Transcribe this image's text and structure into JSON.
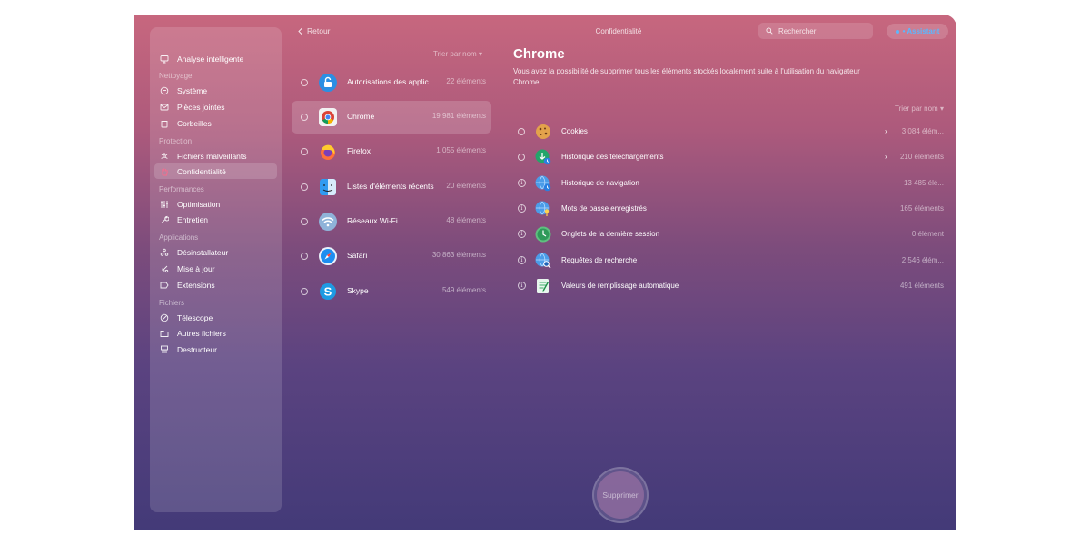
{
  "sidebar": {
    "top_item": {
      "label": "Analyse intelligente",
      "icon": "monitor-icon"
    },
    "sections": [
      {
        "title": "Nettoyage",
        "items": [
          {
            "label": "Système",
            "icon": "system-icon"
          },
          {
            "label": "Pièces jointes",
            "icon": "mail-icon"
          },
          {
            "label": "Corbeilles",
            "icon": "trash-icon"
          }
        ]
      },
      {
        "title": "Protection",
        "items": [
          {
            "label": "Fichiers malveillants",
            "icon": "biohazard-icon"
          },
          {
            "label": "Confidentialité",
            "icon": "hand-icon",
            "active": true
          }
        ]
      },
      {
        "title": "Performances",
        "items": [
          {
            "label": "Optimisation",
            "icon": "sliders-icon"
          },
          {
            "label": "Entretien",
            "icon": "wrench-icon"
          }
        ]
      },
      {
        "title": "Applications",
        "items": [
          {
            "label": "Désinstallateur",
            "icon": "apps-icon"
          },
          {
            "label": "Mise à jour",
            "icon": "update-icon"
          },
          {
            "label": "Extensions",
            "icon": "extensions-icon"
          }
        ]
      },
      {
        "title": "Fichiers",
        "items": [
          {
            "label": "Télescope",
            "icon": "telescope-icon"
          },
          {
            "label": "Autres fichiers",
            "icon": "folder-icon"
          },
          {
            "label": "Destructeur",
            "icon": "shredder-icon"
          }
        ]
      }
    ]
  },
  "toolbar": {
    "back_label": "Retour",
    "title": "Confidentialité",
    "search_placeholder": "Rechercher",
    "assistant_label": "• Assistant"
  },
  "apps": {
    "sort_label": "Trier par nom ▾",
    "items": [
      {
        "name": "Autorisations des applic...",
        "count": "22 éléments",
        "icon": "lock-icon"
      },
      {
        "name": "Chrome",
        "count": "19 981 éléments",
        "icon": "chrome-icon",
        "selected": true
      },
      {
        "name": "Firefox",
        "count": "1 055 éléments",
        "icon": "firefox-icon"
      },
      {
        "name": "Listes d'éléments récents",
        "count": "20 éléments",
        "icon": "finder-icon"
      },
      {
        "name": "Réseaux Wi-Fi",
        "count": "48 éléments",
        "icon": "wifi-icon"
      },
      {
        "name": "Safari",
        "count": "30 863 éléments",
        "icon": "safari-icon"
      },
      {
        "name": "Skype",
        "count": "549 éléments",
        "icon": "skype-icon"
      }
    ]
  },
  "detail": {
    "title": "Chrome",
    "description": "Vous avez la possibilité de supprimer tous les éléments stockés localement suite à l'utilisation du navigateur Chrome.",
    "sort_label": "Trier par nom ▾",
    "categories": [
      {
        "name": "Cookies",
        "count": "3 084 élém...",
        "control": "radio",
        "arrow": "›",
        "icon": "cookie-icon"
      },
      {
        "name": "Historique des téléchargements",
        "count": "210 éléments",
        "control": "radio",
        "arrow": "›",
        "icon": "download-history-icon"
      },
      {
        "name": "Historique de navigation",
        "count": "13 485 élé...",
        "control": "info",
        "icon": "browsing-history-icon"
      },
      {
        "name": "Mots de passe enregistrés",
        "count": "165 éléments",
        "control": "info",
        "icon": "password-icon"
      },
      {
        "name": "Onglets de la dernière session",
        "count": "0 élément",
        "control": "info",
        "icon": "clock-icon"
      },
      {
        "name": "Requêtes de recherche",
        "count": "2 546 élém...",
        "control": "info",
        "icon": "search-query-icon"
      },
      {
        "name": "Valeurs de remplissage automatique",
        "count": "491 éléments",
        "control": "info",
        "icon": "autofill-icon"
      }
    ]
  },
  "remove_button": {
    "label": "Supprimer"
  }
}
